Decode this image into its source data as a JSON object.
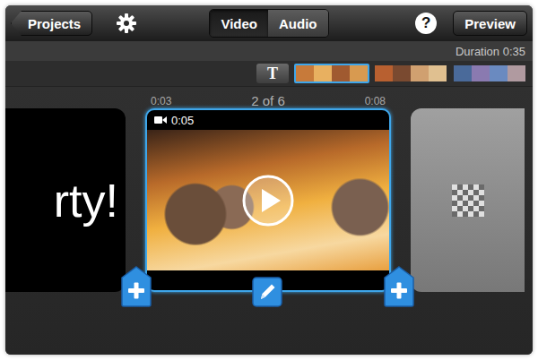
{
  "toolbar": {
    "back_button": "Projects",
    "tabs": [
      {
        "label": "Video",
        "selected": true
      },
      {
        "label": "Audio",
        "selected": false
      }
    ],
    "help": "?",
    "preview_button": "Preview"
  },
  "duration": "Duration 0:35",
  "strip": {
    "items": [
      {
        "kind": "title",
        "label": "T",
        "selected": false
      },
      {
        "kind": "clip",
        "selected": true
      },
      {
        "kind": "clip",
        "selected": false
      },
      {
        "kind": "clip",
        "selected": false
      }
    ]
  },
  "timeline": {
    "start_time": "0:03",
    "position": "2 of 6",
    "end_time": "0:08",
    "clips": [
      {
        "kind": "title",
        "text": "rty!",
        "selected": false
      },
      {
        "kind": "video",
        "duration": "0:05",
        "selected": true
      },
      {
        "kind": "transition",
        "selected": false
      }
    ]
  }
}
